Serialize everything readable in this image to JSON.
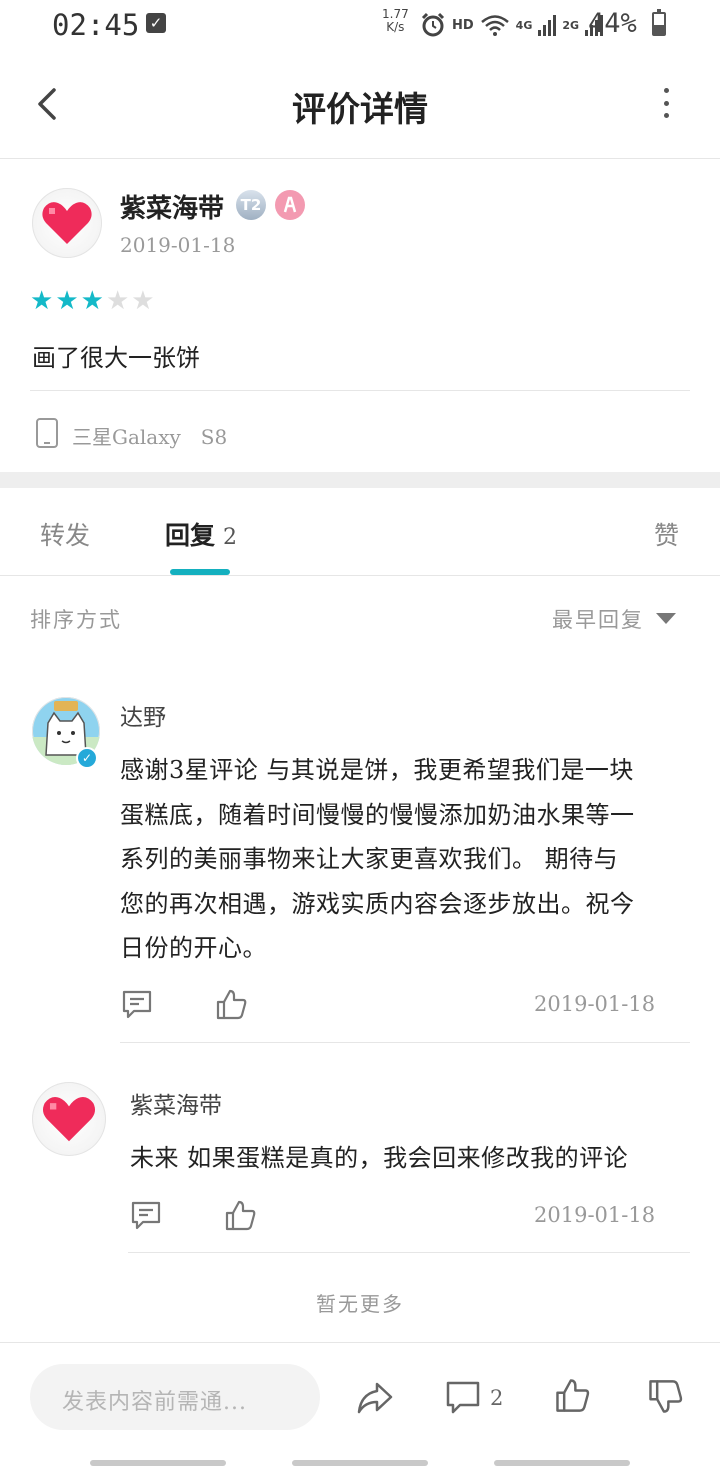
{
  "status_bar": {
    "time": "02:45",
    "speed_value": "1.77",
    "speed_unit": "K/s",
    "hd": "HD",
    "net_4g": "4G",
    "net_2g": "2G",
    "battery": "44%"
  },
  "header": {
    "title": "评价详情"
  },
  "review": {
    "user_name": "紫菜海带",
    "level_badge": "T2",
    "date": "2019-01-18",
    "rating": 3,
    "rating_max": 5,
    "text": "画了很大一张饼",
    "device": "三星Galaxy　S8"
  },
  "tabs": {
    "forward": "转发",
    "reply": "回复",
    "reply_count": "2",
    "like": "赞"
  },
  "sort": {
    "label": "排序方式",
    "value": "最早回复"
  },
  "replies": [
    {
      "name": "达野",
      "lines": [
        "感谢3星评论 与其说是饼，我更希望我们是一块",
        "蛋糕底，随着时间慢慢的慢慢添加奶油水果等一",
        "系列的美丽事物来让大家更喜欢我们。 期待与",
        "您的再次相遇，游戏实质内容会逐步放出。祝今",
        "日份的开心。"
      ],
      "date": "2019-01-18"
    },
    {
      "name": "紫菜海带",
      "lines": [
        "未来 如果蛋糕是真的，我会回来修改我的评论"
      ],
      "date": "2019-01-18"
    }
  ],
  "no_more": "暂无更多",
  "bottom_bar": {
    "input_placeholder": "发表内容前需通...",
    "comment_count": "2"
  },
  "colors": {
    "accent": "#14b0bf",
    "star_on": "#14b9c8",
    "star_off": "#dedede",
    "heart": "#ef2b5a"
  },
  "icons": [
    "back-arrow-icon",
    "more-vertical-icon",
    "phone-icon",
    "comment-icon",
    "thumbs-up-icon",
    "share-icon",
    "thumbs-down-icon",
    "dropdown-caret-icon"
  ]
}
